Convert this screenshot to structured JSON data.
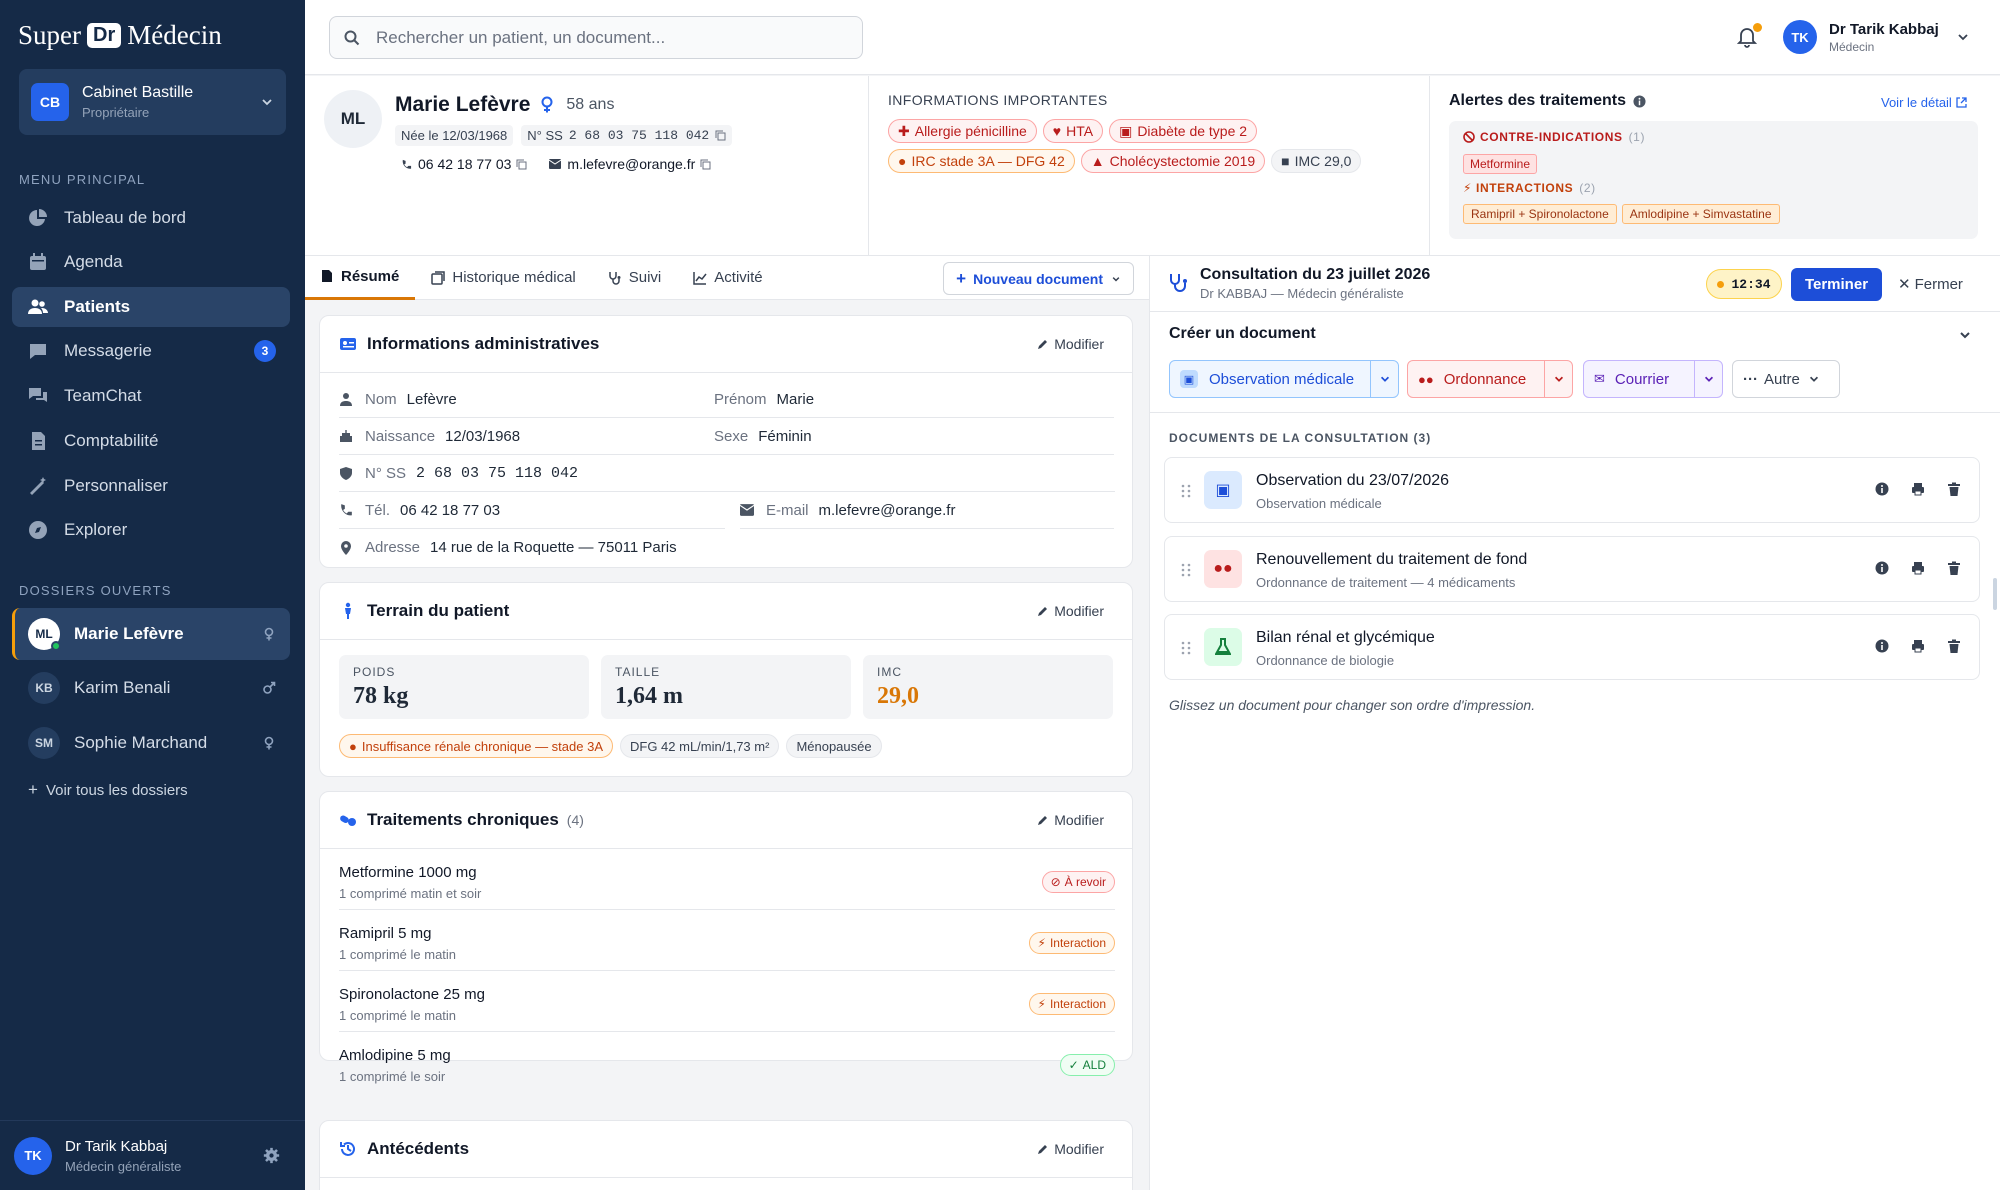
{
  "brand": {
    "pre": "Super",
    "mid": "Dr",
    "post": "Médecin"
  },
  "cabinet": {
    "initials": "CB",
    "name": "Cabinet Bastille",
    "role": "Propriétaire"
  },
  "sidebar": {
    "menu_title": "MENU PRINCIPAL",
    "items": [
      {
        "label": "Tableau de bord",
        "icon": "pie-chart-icon"
      },
      {
        "label": "Agenda",
        "icon": "calendar-icon"
      },
      {
        "label": "Patients",
        "icon": "users-icon",
        "active": true
      },
      {
        "label": "Messagerie",
        "icon": "message-icon",
        "badge": "3"
      },
      {
        "label": "TeamChat",
        "icon": "chat-icon"
      },
      {
        "label": "Comptabilité",
        "icon": "invoice-icon"
      },
      {
        "label": "Personnaliser",
        "icon": "wand-icon"
      },
      {
        "label": "Explorer",
        "icon": "compass-icon"
      }
    ],
    "dossiers_title": "DOSSIERS OUVERTS",
    "dossiers": [
      {
        "initials": "ML",
        "name": "Marie Lefèvre",
        "active": true
      },
      {
        "initials": "KB",
        "name": "Karim Benali"
      },
      {
        "initials": "SM",
        "name": "Sophie Marchand"
      }
    ],
    "see_all": "Voir tous les dossiers",
    "user": {
      "initials": "TK",
      "name": "Dr Tarik Kabbaj",
      "role": "Médecin généraliste"
    }
  },
  "topbar": {
    "search_placeholder": "Rechercher un patient, un document...",
    "user": {
      "initials": "TK",
      "name": "Dr Tarik Kabbaj",
      "role": "Médecin"
    }
  },
  "patient": {
    "initials": "ML",
    "name": "Marie Lefèvre",
    "age": "58 ans",
    "birth": "Née le 12/03/1968",
    "ss_label": "N° SS",
    "ss": "2 68 03 75 118 042",
    "phone": "06 42 18 77 03",
    "email": "m.lefevre@orange.fr"
  },
  "important": {
    "title": "INFORMATIONS IMPORTANTES",
    "chips": [
      "Allergie pénicilline",
      "HTA",
      "Diabète de type 2",
      "IRC stade 3A — DFG 42",
      "Cholécystectomie 2019",
      "IMC 29,0"
    ]
  },
  "alerts": {
    "title": "Alertes des traitements",
    "link": "Voir le détail",
    "contra_label": "CONTRE-INDICATIONS",
    "contra_count": "(1)",
    "contra": [
      "Metformine"
    ],
    "inter_label": "INTERACTIONS",
    "inter_count": "(2)",
    "inter": [
      "Ramipril + Spironolactone",
      "Amlodipine + Simvastatine"
    ]
  },
  "tabs": [
    "Résumé",
    "Historique médical",
    "Suivi",
    "Activité"
  ],
  "new_doc": "Nouveau document",
  "admin": {
    "title": "Informations administratives",
    "modify": "Modifier",
    "nom_l": "Nom",
    "nom": "Lefèvre",
    "prenom_l": "Prénom",
    "prenom": "Marie",
    "naissance_l": "Naissance",
    "naissance": "12/03/1968",
    "sexe_l": "Sexe",
    "sexe": "Féminin",
    "ss_l": "N° SS",
    "ss": "2 68 03 75 118 042",
    "tel_l": "Tél.",
    "tel": "06 42 18 77 03",
    "email_l": "E-mail",
    "email": "m.lefevre@orange.fr",
    "adresse_l": "Adresse",
    "adresse": "14 rue de la Roquette — 75011 Paris"
  },
  "terrain": {
    "title": "Terrain du patient",
    "modify": "Modifier",
    "poids_l": "POIDS",
    "poids": "78 kg",
    "taille_l": "TAILLE",
    "taille": "1,64 m",
    "imc_l": "IMC",
    "imc": "29,0",
    "chips": [
      "Insuffisance rénale chronique — stade 3A",
      "DFG 42 mL/min/1,73 m²",
      "Ménopausée"
    ]
  },
  "traitements": {
    "title": "Traitements chroniques",
    "count": "(4)",
    "modify": "Modifier",
    "items": [
      {
        "name": "Metformine 1000 mg",
        "dose": "1 comprimé matin et soir",
        "tag": "À revoir"
      },
      {
        "name": "Ramipril 5 mg",
        "dose": "1 comprimé le matin",
        "tag": "Interaction"
      },
      {
        "name": "Spironolactone 25 mg",
        "dose": "1 comprimé le matin",
        "tag": "Interaction"
      },
      {
        "name": "Amlodipine 5 mg",
        "dose": "1 comprimé le soir",
        "tag": "ALD"
      }
    ]
  },
  "antecedents": {
    "title": "Antécédents",
    "modify": "Modifier"
  },
  "consultation": {
    "title": "Consultation du 23 juillet 2026",
    "subtitle": "Dr KABBAJ — Médecin généraliste",
    "timer": "12:34",
    "finish": "Terminer",
    "close": "Fermer"
  },
  "create": {
    "title": "Créer un document",
    "buttons": [
      "Observation médicale",
      "Ordonnance",
      "Courrier",
      "Autre"
    ]
  },
  "documents": {
    "title": "DOCUMENTS DE LA CONSULTATION (3)",
    "items": [
      {
        "title": "Observation du 23/07/2026",
        "sub": "Observation médicale"
      },
      {
        "title": "Renouvellement du traitement de fond",
        "sub": "Ordonnance de traitement — 4 médicaments"
      },
      {
        "title": "Bilan rénal et glycémique",
        "sub": "Ordonnance de biologie"
      }
    ],
    "hint": "Glissez un document pour changer son ordre d'impression."
  },
  "colors": {
    "sidebar": "#152a47",
    "accent": "#2563eb",
    "warning": "#d97706",
    "danger": "#b91c1c"
  }
}
